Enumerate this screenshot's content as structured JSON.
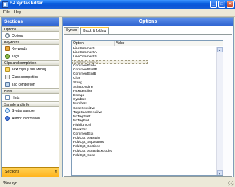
{
  "window": {
    "title": "RJ Syntax Editor"
  },
  "menu": [
    "File",
    "Help"
  ],
  "sidebar": {
    "header": "Sections",
    "sections": [
      {
        "title": "Options",
        "items": [
          {
            "label": "Options",
            "icon": "options-icon"
          }
        ]
      },
      {
        "title": "Keywords",
        "items": [
          {
            "label": "Keywords",
            "icon": "keywords-icon"
          },
          {
            "label": "Tags",
            "icon": "tags-icon"
          }
        ]
      },
      {
        "title": "Clips and completion",
        "items": [
          {
            "label": "Text clips [User Menu]",
            "icon": "text-clips-icon"
          },
          {
            "label": "Class completion",
            "icon": "class-completion-icon"
          },
          {
            "label": "Tag completion",
            "icon": "tag-completion-icon"
          }
        ]
      },
      {
        "title": "Hints",
        "items": [
          {
            "label": "Hints",
            "icon": "hints-icon"
          }
        ]
      },
      {
        "title": "Sample and info",
        "items": [
          {
            "label": "Syntax sample",
            "icon": "syntax-sample-icon"
          },
          {
            "label": "Author information",
            "icon": "author-info-icon"
          }
        ]
      }
    ],
    "footer": "Sections"
  },
  "main": {
    "header": "Options",
    "tabs": [
      "Syntax",
      "Block & folding"
    ],
    "active_tab": 1,
    "grid": {
      "columns": [
        "Option",
        "Value"
      ],
      "rows": [
        "LineComment",
        "LineCommentA",
        "LineCommentB",
        "CommentStartA",
        "CommentEndA",
        "CommentStartB",
        "CommentEndB",
        "Char",
        "String",
        "StringOnLine",
        "HexIdentifier",
        "Escape",
        "Symbols",
        "Numbers",
        "CaseSensitive",
        "TagsCaseSensitive",
        "NoTagStart",
        "NoTagEnd",
        "HighlightUrl",
        "BlockEsc",
        "CommentEsc",
        "FoldOpt_AsBegin",
        "FoldOpt_Separators",
        "FoldOpt_Sections",
        "FoldOpt_AutoEdExcludes",
        "FoldOpt_Case"
      ],
      "selected_row": 3
    }
  },
  "status": {
    "text": "*New.syn"
  }
}
